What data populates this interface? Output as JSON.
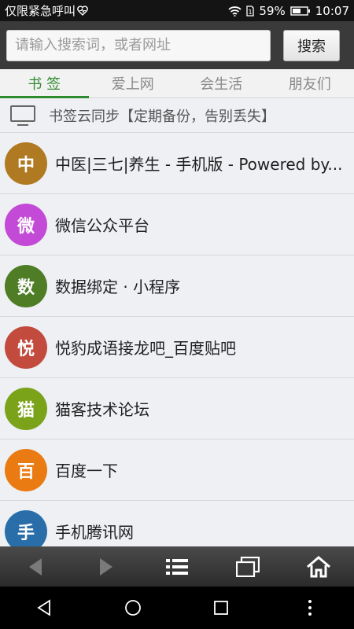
{
  "status_bar": {
    "carrier": "仅限紧急呼叫",
    "battery": "59%",
    "time": "10:07"
  },
  "search": {
    "placeholder": "请输入搜索词，或者网址",
    "button_label": "搜索"
  },
  "tabs": [
    {
      "label": "书 签",
      "active": true
    },
    {
      "label": "爱上网",
      "active": false
    },
    {
      "label": "会生活",
      "active": false
    },
    {
      "label": "朋友们",
      "active": false
    }
  ],
  "sync": {
    "label": "书签云同步【定期备份，告别丢失】",
    "icon": "monitor-icon"
  },
  "bookmarks": [
    {
      "avatar": "中",
      "title": "中医|三七|养生 - 手机版 - Powered by...",
      "color": "#b07a22"
    },
    {
      "avatar": "微",
      "title": "微信公众平台",
      "color": "#c34ad6"
    },
    {
      "avatar": "数",
      "title": "数据绑定 · 小程序",
      "color": "#4e7d25"
    },
    {
      "avatar": "悦",
      "title": "悦豹成语接龙吧_百度贴吧",
      "color": "#c24b3e"
    },
    {
      "avatar": "猫",
      "title": "猫客技术论坛",
      "color": "#7aa31a"
    },
    {
      "avatar": "百",
      "title": "百度一下",
      "color": "#ea7b12"
    },
    {
      "avatar": "手",
      "title": "手机腾讯网",
      "color": "#2a6ea9"
    }
  ],
  "toolbar": {
    "icons": [
      "back-icon",
      "forward-icon",
      "menu-icon",
      "windows-icon",
      "home-icon"
    ]
  },
  "sysnav": {
    "icons": [
      "nav-back-icon",
      "nav-home-icon",
      "nav-recents-icon",
      "nav-more-icon"
    ]
  },
  "colors": {
    "accent": "#2f8b2f",
    "toolbar": "#333333",
    "status_bar": "#141414"
  }
}
